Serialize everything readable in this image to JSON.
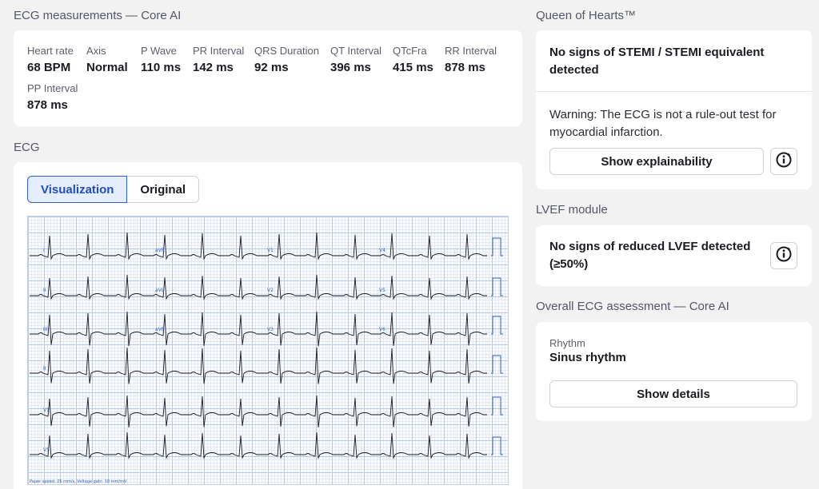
{
  "measurements": {
    "title": "ECG measurements — Core AI",
    "items": [
      {
        "label": "Heart rate",
        "value": "68 BPM"
      },
      {
        "label": "Axis",
        "value": "Normal"
      },
      {
        "label": "P Wave",
        "value": "110 ms"
      },
      {
        "label": "PR Interval",
        "value": "142 ms"
      },
      {
        "label": "QRS Duration",
        "value": "92 ms"
      },
      {
        "label": "QT Interval",
        "value": "396 ms"
      },
      {
        "label": "QTcFra",
        "value": "415 ms"
      },
      {
        "label": "RR Interval",
        "value": "878 ms"
      },
      {
        "label": "PP Interval",
        "value": "878 ms"
      }
    ]
  },
  "ecg": {
    "title": "ECG",
    "tabs": [
      "Visualization",
      "Original"
    ],
    "active_tab": "Visualization",
    "lead_labels": [
      "I",
      "aVR",
      "V1",
      "V4",
      "II",
      "aVL",
      "V2",
      "V5",
      "III",
      "aVF",
      "V3",
      "V6",
      "II",
      "V1",
      "V5"
    ],
    "footer": "Paper speed: 25 mm/s, Voltage gain: 10 mm/mV"
  },
  "queen_of_hearts": {
    "title": "Queen of Hearts™",
    "result": "No signs of STEMI / STEMI equivalent detected",
    "warning": "Warning: The ECG is not a rule-out test for myocardial infarction.",
    "button": "Show explainability",
    "info_icon": "info-icon"
  },
  "lvef": {
    "title": "LVEF module",
    "result": "No signs of reduced LVEF detected (≥50%)",
    "info_icon": "info-icon"
  },
  "overall": {
    "title": "Overall ECG assessment — Core AI",
    "rhythm_label": "Rhythm",
    "rhythm_value": "Sinus rhythm",
    "button": "Show details"
  },
  "colors": {
    "accent": "#2f5fc8",
    "tab_active_bg": "#e5eeff",
    "ecg_grid": "#b5c8ea",
    "background": "#f2f2f3"
  }
}
